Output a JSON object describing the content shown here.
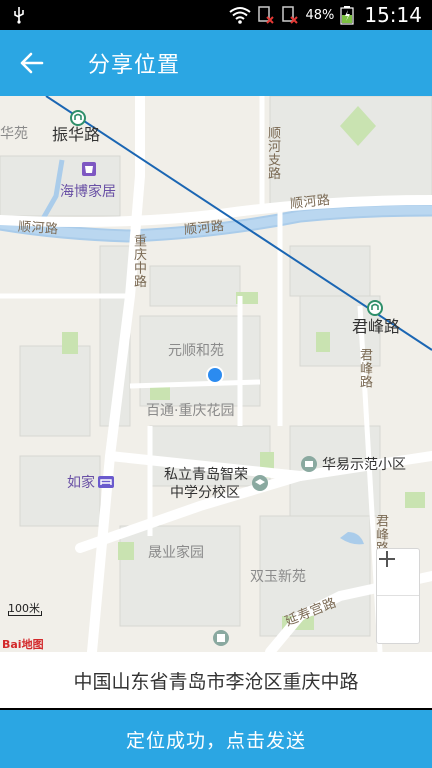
{
  "status_bar": {
    "battery": "48%",
    "time": "15:14"
  },
  "app_bar": {
    "title": "分享位置"
  },
  "map": {
    "labels": {
      "hua_yuan": "华苑",
      "zhenhua_road": "振华路",
      "haibo_home": "海博家居",
      "shunhe_zhilu": "顺河支路",
      "shunhe_road_left": "顺河路",
      "shunhe_road_mid": "顺河路",
      "shunhe_road_right": "顺河路",
      "chongqing_zhonglu": "重庆中路",
      "junfeng_road_station": "君峰路",
      "junfeng_road_vertical": "君峰路",
      "yuanshun_heyuan": "元顺和苑",
      "baitong_chongqing_huayuan": "百通·重庆花园",
      "rujia": "如家",
      "private_school": "私立青岛智荣",
      "private_school_2": "中学分校区",
      "huayi_community": "华易示范小区",
      "junfeng_road_2": "君峰路",
      "chenye_jiayuan": "晟业家园",
      "shuangyu_xinyuan": "双玉新苑",
      "yanshou_gong_road": "延寿宫路"
    },
    "scale_label": "100米",
    "brand": "Bai地图"
  },
  "address_text": "中国山东省青岛市李沧区重庆中路",
  "send_button": "定位成功，点击发送"
}
